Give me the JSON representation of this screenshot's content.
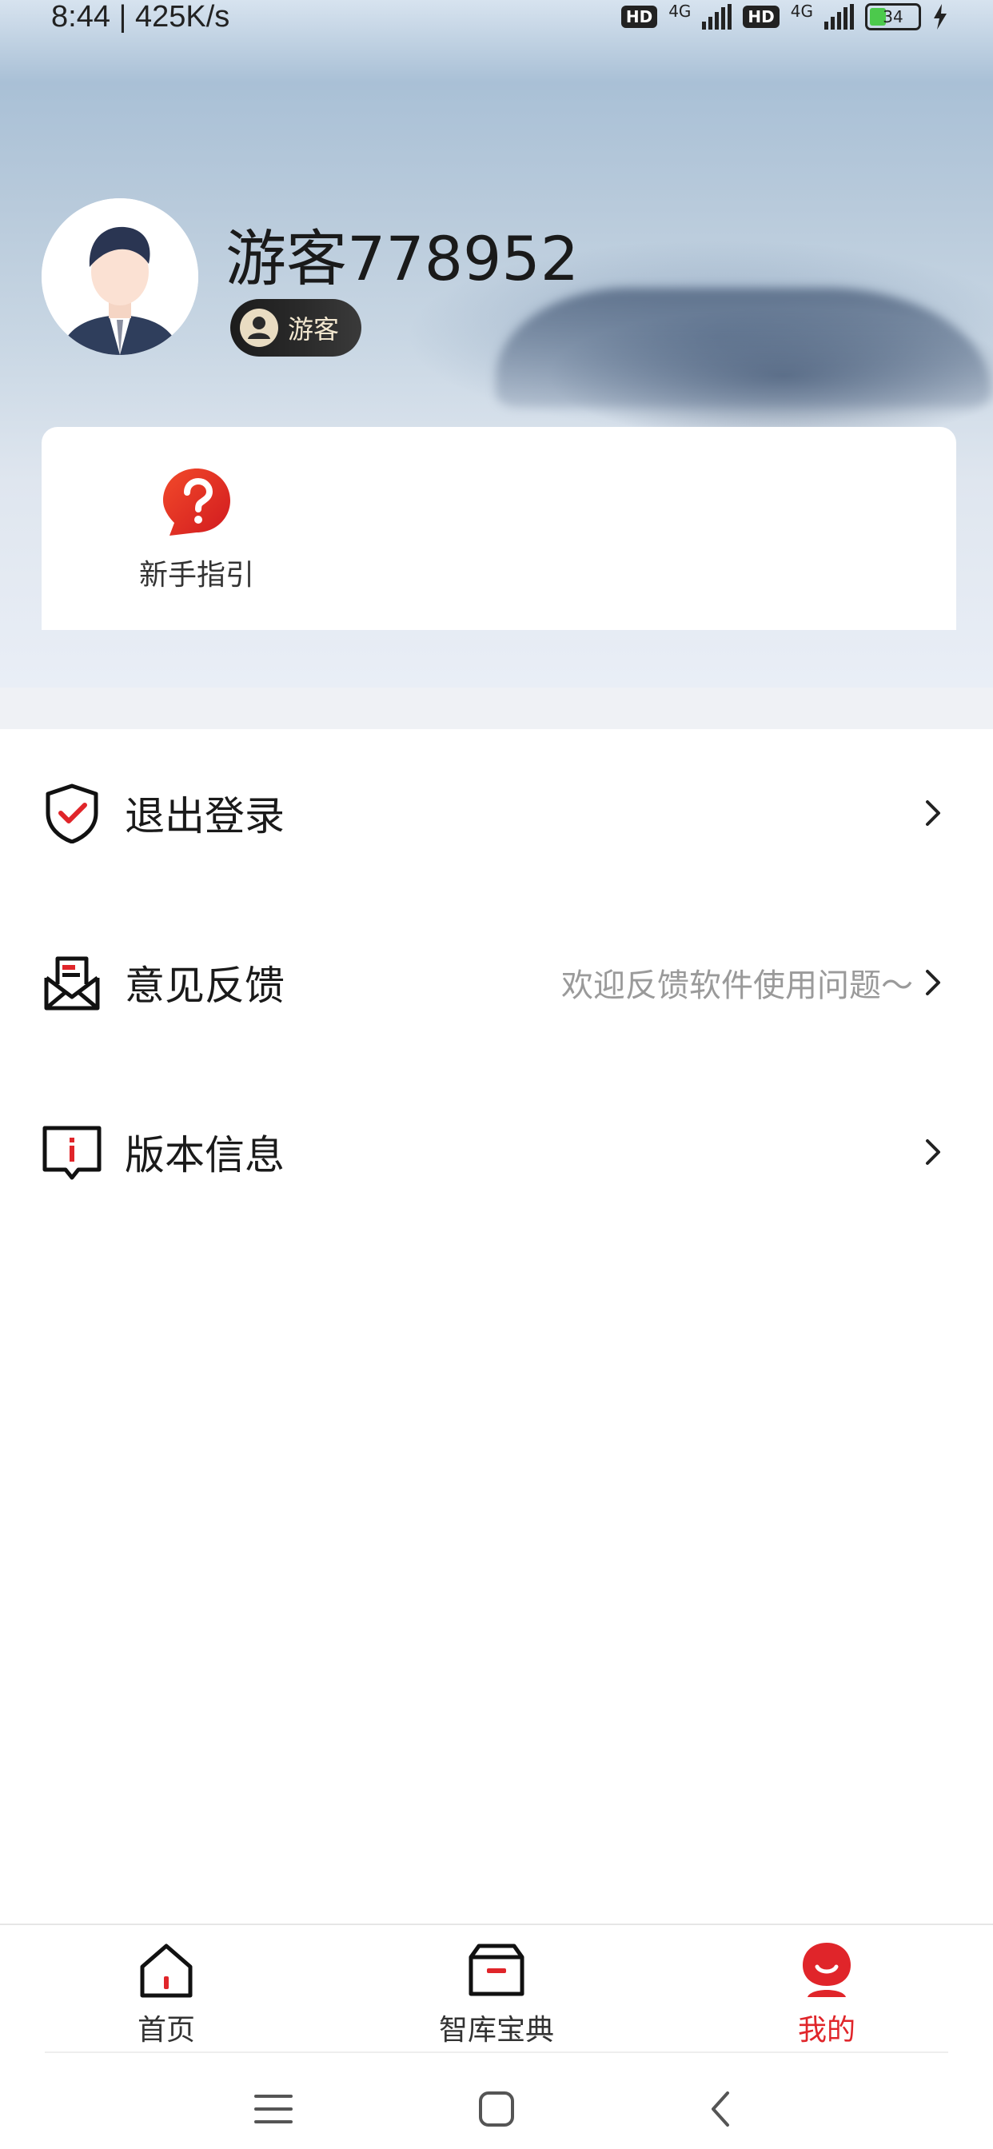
{
  "status_bar": {
    "time": "8:44 | 425K/s",
    "hd1": "HD",
    "net1": "4G",
    "hd2": "HD",
    "net2": "4G",
    "battery": "34"
  },
  "profile": {
    "username": "游客778952",
    "badge_label": "游客"
  },
  "guide": {
    "label": "新手指引",
    "icon": "question-bubble-icon"
  },
  "menu": {
    "logout": {
      "label": "退出登录",
      "icon": "shield-check-icon"
    },
    "feedback": {
      "label": "意见反馈",
      "hint": "欢迎反馈软件使用问题～",
      "icon": "mail-envelope-icon"
    },
    "version": {
      "label": "版本信息",
      "icon": "info-message-icon"
    }
  },
  "tabs": {
    "home": "首页",
    "library": "智库宝典",
    "mine": "我的"
  },
  "colors": {
    "accent": "#e0252a",
    "badge_bg": "#1c1c1c"
  }
}
